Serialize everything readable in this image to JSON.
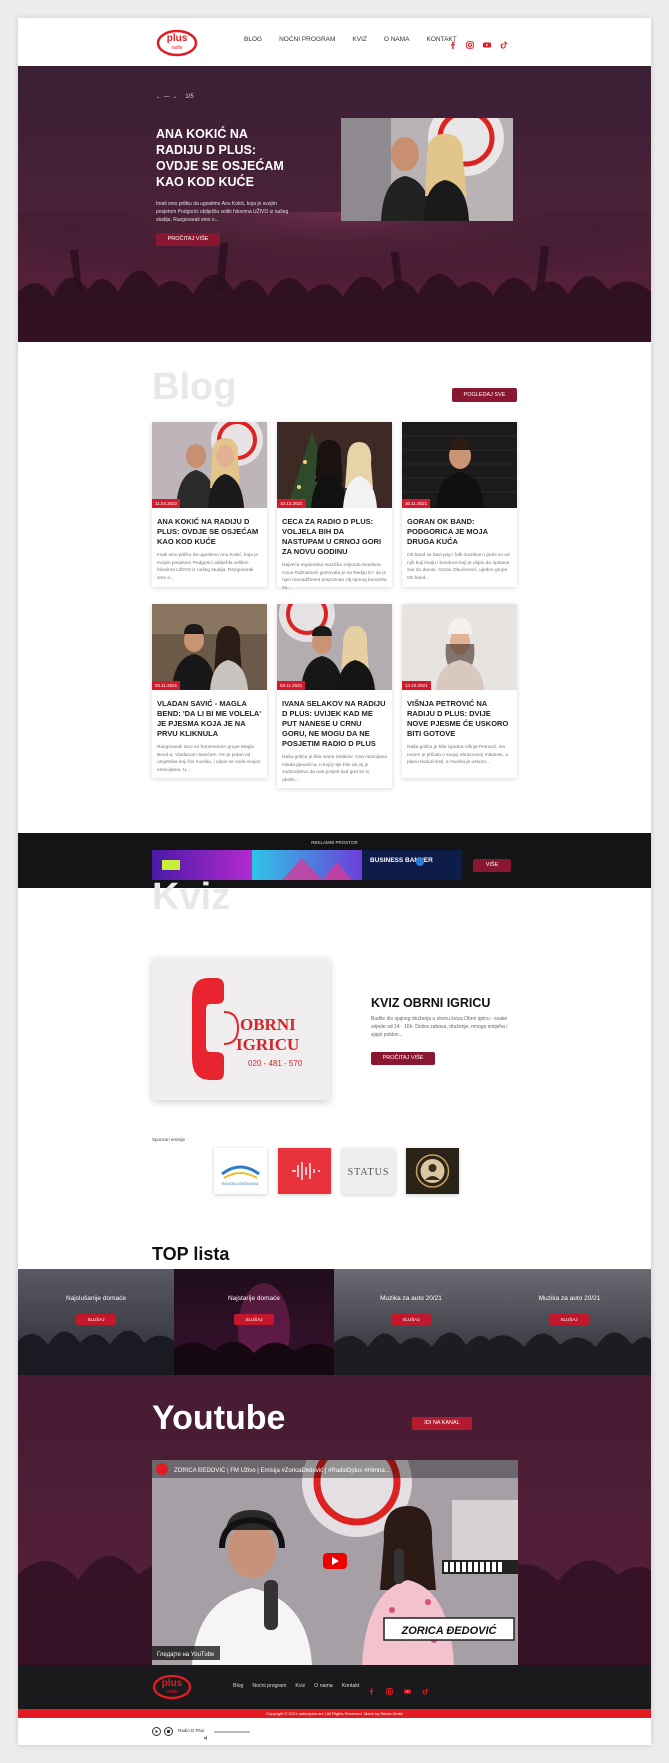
{
  "header": {
    "logo_text": "plus",
    "logo_sub": "radio",
    "nav": [
      "BLOG",
      "NOĆNI PROGRAM",
      "KVIZ",
      "O NAMA",
      "KONTAKT"
    ]
  },
  "hero": {
    "counter": "1/5",
    "title": "ANA KOKIĆ NA RADIJU D PLUS: OVDJE SE OSJEĆAM KAO KOD KUĆE",
    "text": "Imali smo priliku da ugostimo Anu Kokić, koja je svojim posjetom Podgorici obilježila veliki hitovima UŽIVO iz našeg studija. Razgovarali smo o...",
    "button": "PROČITAJ VIŠE"
  },
  "blog": {
    "title": "Blog",
    "see_all": "POGLEDAJ SVE",
    "posts": [
      {
        "date": "11.04.2022",
        "title": "ANA KOKIĆ NA RADIJU D PLUS: OVDJE SE OSJEĆAM KAO KOD KUĆE",
        "excerpt": "Imali smo priliku da ugostimo Anu Kokić, koja je svojim posjetom Podgorici obilježila velikim hitovima UŽIVO iz našeg studija. Razgovarali smo o..."
      },
      {
        "date": "10.12.2021",
        "title": "CECA ZA RADIO D PLUS: VOLJELA BIH DA NASTUPAM U CRNOJ GORI ZA NOVU GODINU",
        "excerpt": "Najveća regionalna muzička zvijezda Svetlana Ceca Ražnatović gostovala je na Radiju D+ da je njen menadžment prepoznao cilj njenog koncerta za..."
      },
      {
        "date": "30.11.2021",
        "title": "GORAN OK BAND: PODGORICA JE MOJA DRUGA KUĆA",
        "excerpt": "Ok band se bavi pop i folk muzikom i jedni su od njih koji imaju i bendove koji je ušpio da opstane sve do danas. Goran Obućinović, ujedno grupe Ok band..."
      },
      {
        "date": "03.11.2021",
        "title": "VLADAN SAVIĆ - MAGLA BEND: 'DA LI BI ME VOLELA' JE PJESMA KOJA JE NA PRVU KLIKNULA",
        "excerpt": "Razgovarali smo sa frontmenom grupe Magla Bend-a, Vladanom Savićem. On je jedan od umjetnika koji živi muziku, i ušpio se vodu svojim emocijama. U..."
      },
      {
        "date": "03.11.2021",
        "title": "IVANA SELAKOV NA RADIJU D PLUS: UVIJEK KAD ME PUT NANESE U CRNU GORU, NE MOGU DA NE POSJETIM RADIO D PLUS",
        "excerpt": "Naša gošća je bila Ivana Selakov. Ova nasmijana mlada pjevačica, u kojoj nije bilo da joj je zadovoljstvo da nas posjeti kad god se to ukaže..."
      },
      {
        "date": "14.10.2021",
        "title": "VIŠNJA PETROVIĆ NA RADIJU D PLUS: DVIJE NOVE PJESME ĆE USKORO BITI GOTOVE",
        "excerpt": "Naša gošća je bila zgodna Višnja Petrović. Sa mnom je pričala o svojoj obrazovnoj mladosti, a planu budućnosti, a muzika je uskoro..."
      }
    ]
  },
  "ads": {
    "label": "REKLAMNI PROSTOR",
    "banner_text": "BUSINESS BANNER",
    "button": "VIŠE"
  },
  "kviz": {
    "title": "Kviz",
    "heading": "KVIZ OBRNI IGRICU",
    "text": "Budite dio sjajnog druženja u okviru kviza Obrni igricu - svake srijede od 14 - 16h. Dobra zabava, druženje, mnogo smijeha i sjajni poklon...",
    "button": "PROČITAJ VIŠE",
    "image_line1": "OBRNI",
    "image_line2": "IGRICU",
    "image_phone": "020 - 481 - 570",
    "sponsors_label": "Sponzori emisije",
    "sponsors": [
      "RADIONA ODRŽAVANJA",
      "LOGO",
      "STATUS",
      "SEAL"
    ]
  },
  "toplista": {
    "title": "TOP lista",
    "items": [
      {
        "title": "Najslušanije domaće",
        "button": "SLUŠAJ"
      },
      {
        "title": "Najstarije domaće",
        "button": "SLUŠAJ"
      },
      {
        "title": "Muzika za auto 20/21",
        "button": "SLUŠAJ"
      },
      {
        "title": "Muzika za auto 20/21",
        "button": "SLUŠAJ"
      }
    ]
  },
  "youtube": {
    "title": "Youtube",
    "button": "IDI NA KANAL",
    "video_title": "ZORICA ĐEDOVIĆ | FM Uživo | Emisija #ZoricaĐedović | #RadioDplus #Himna...",
    "name_banner": "ZORICA ĐEDOVIĆ",
    "watch_label": "Гледајте на YouTube"
  },
  "footer": {
    "nav": [
      "Blog",
      "Noćni program",
      "Kviz",
      "O nama",
      "Kontakt"
    ],
    "copyright": "Copyright © 2021 radiodplus.me | All Rights Reserved. Made by Nikola Dedić",
    "player_name": "Radio D Plus"
  },
  "colors": {
    "accent": "#8a1731",
    "red": "#e31b23",
    "hero_bg": "#4a2138"
  }
}
